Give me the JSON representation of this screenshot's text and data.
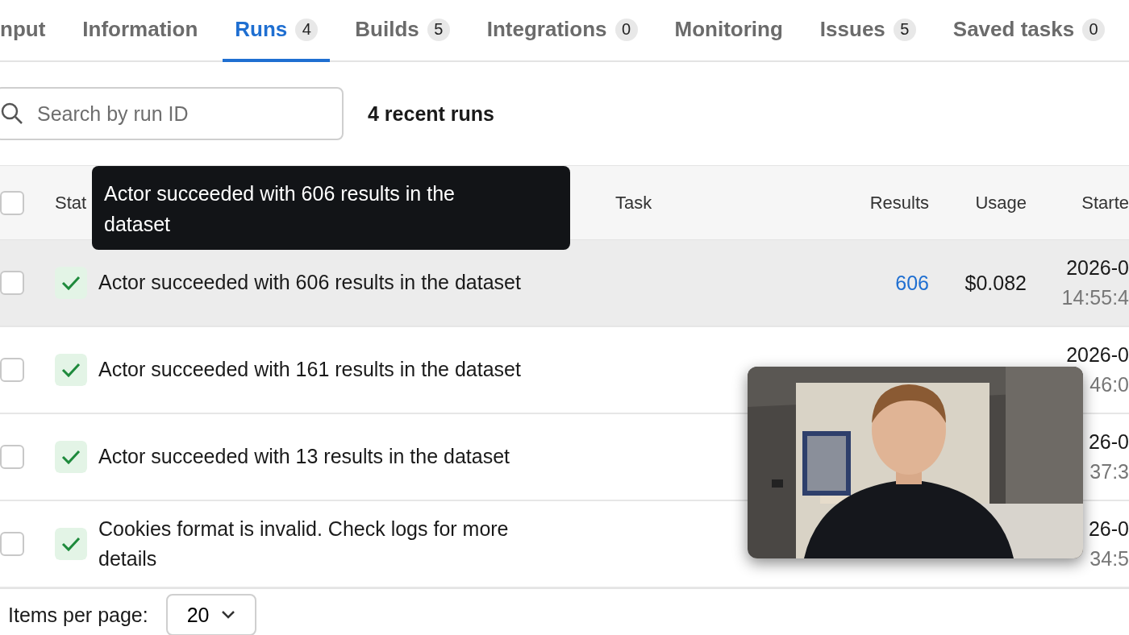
{
  "tabs": [
    {
      "label": "nput",
      "selected": false
    },
    {
      "label": "Information",
      "selected": false
    },
    {
      "label": "Runs",
      "count": "4",
      "selected": true
    },
    {
      "label": "Builds",
      "count": "5",
      "selected": false
    },
    {
      "label": "Integrations",
      "count": "0",
      "selected": false
    },
    {
      "label": "Monitoring",
      "selected": false
    },
    {
      "label": "Issues",
      "count": "5",
      "selected": false
    },
    {
      "label": "Saved tasks",
      "count": "0",
      "selected": false
    }
  ],
  "search": {
    "placeholder": "Search by run ID"
  },
  "run_count": "4 recent runs",
  "table": {
    "select_all_checked": false,
    "columns": [
      "Stat",
      "Task",
      "Results",
      "Usage",
      "Starte"
    ],
    "rows": [
      {
        "checked": false,
        "hovered": true,
        "succeeded": true,
        "status": "Actor succeeded with 606 results in the dataset",
        "results": "606",
        "usage": "$0.082",
        "date": "2026-0",
        "time": "14:55:4"
      },
      {
        "checked": false,
        "hovered": false,
        "succeeded": true,
        "status": "Actor succeeded with 161 results in the dataset",
        "date": "2026-0",
        "time": "46:0"
      },
      {
        "checked": false,
        "hovered": false,
        "succeeded": true,
        "status": "Actor succeeded with 13 results in the dataset",
        "date": "26-0",
        "time": "37:3"
      },
      {
        "checked": false,
        "hovered": false,
        "succeeded": true,
        "status": "Cookies format is invalid. Check logs for more details",
        "date": "26-0",
        "time": "34:5"
      }
    ]
  },
  "tooltip": "Actor succeeded with 606 results in the dataset",
  "pagination": {
    "label": "Items per page:",
    "value": "20"
  }
}
